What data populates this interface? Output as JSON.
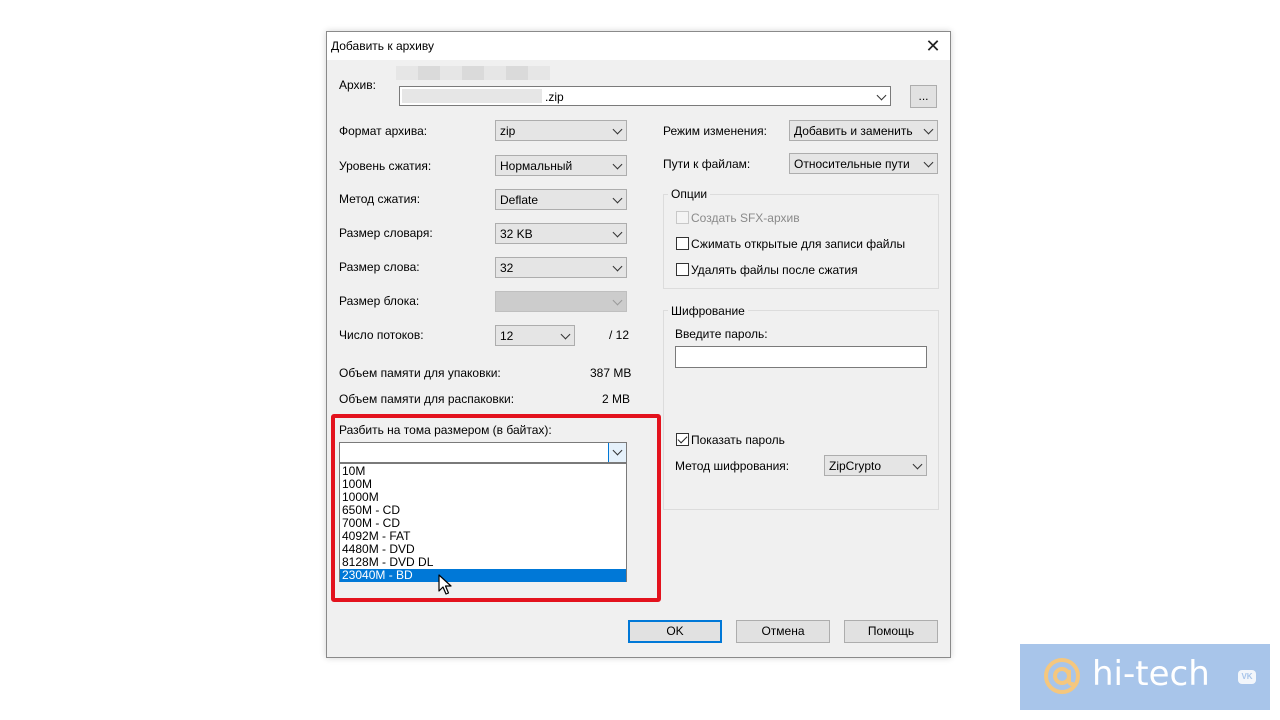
{
  "window": {
    "title": "Добавить к архиву"
  },
  "archive": {
    "label": "Архив:",
    "filename": ".zip",
    "browse_label": "..."
  },
  "left_fields": {
    "format_label": "Формат архива:",
    "format_value": "zip",
    "level_label": "Уровень сжатия:",
    "level_value": "Нормальный",
    "method_label": "Метод сжатия:",
    "method_value": "Deflate",
    "dict_label": "Размер словаря:",
    "dict_value": "32 KB",
    "word_label": "Размер слова:",
    "word_value": "32",
    "block_label": "Размер блока:",
    "threads_label": "Число потоков:",
    "threads_value": "12",
    "threads_max": "/ 12",
    "mem_pack_label": "Объем памяти для упаковки:",
    "mem_pack_value": "387 MB",
    "mem_unpack_label": "Объем памяти для распаковки:",
    "mem_unpack_value": "2 MB"
  },
  "split": {
    "label": "Разбить на тома размером (в байтах):",
    "value": "",
    "options": [
      "10M",
      "100M",
      "1000M",
      "650M - CD",
      "700M - CD",
      "4092M - FAT",
      "4480M - DVD",
      "8128M - DVD DL",
      "23040M - BD"
    ],
    "selected_index": 8
  },
  "right_fields": {
    "update_label": "Режим изменения:",
    "update_value": "Добавить и заменить",
    "paths_label": "Пути к файлам:",
    "paths_value": "Относительные пути"
  },
  "options": {
    "title": "Опции",
    "sfx": "Создать SFX-архив",
    "compress_shared": "Сжимать открытые для записи файлы",
    "delete_after": "Удалять файлы после сжатия"
  },
  "encryption": {
    "title": "Шифрование",
    "password_label": "Введите пароль:",
    "password_value": "",
    "show_password": "Показать пароль",
    "method_label": "Метод шифрования:",
    "method_value": "ZipCrypto"
  },
  "buttons": {
    "ok": "OK",
    "cancel": "Отмена",
    "help": "Помощь"
  },
  "watermark": {
    "text": "hi-tech",
    "badge": "VK"
  }
}
